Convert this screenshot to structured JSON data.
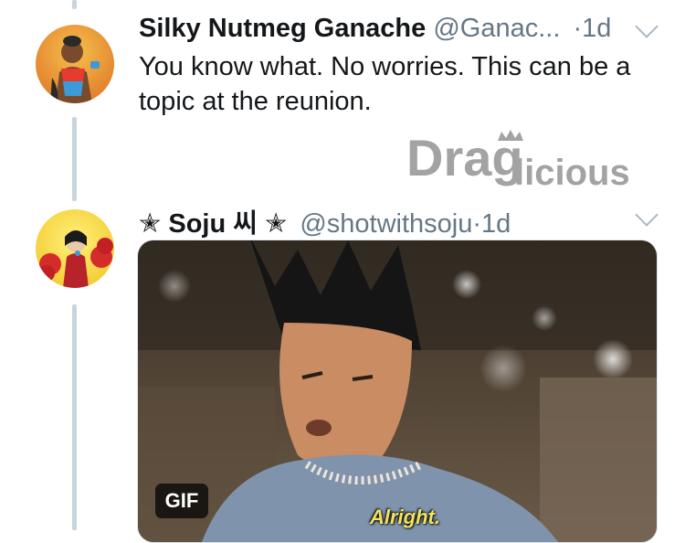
{
  "tweets": [
    {
      "name": "Silky Nutmeg Ganache",
      "handle": "@Ganac...",
      "separator": "·",
      "time": "1d",
      "text": "You know what. No worries. This can be a topic at the reunion."
    },
    {
      "name": "✭ Soju 씨 ✭",
      "handle": "@shotwithsoju",
      "separator": "·",
      "time": "1d",
      "media": {
        "badge": "GIF",
        "subtitle": "Alright."
      }
    }
  ],
  "watermark": "Draglicious",
  "icons": {
    "menu": "chevron-down-icon"
  },
  "colors": {
    "text": "#14171a",
    "secondary": "#657786",
    "thread_line": "#c9d3dc"
  }
}
